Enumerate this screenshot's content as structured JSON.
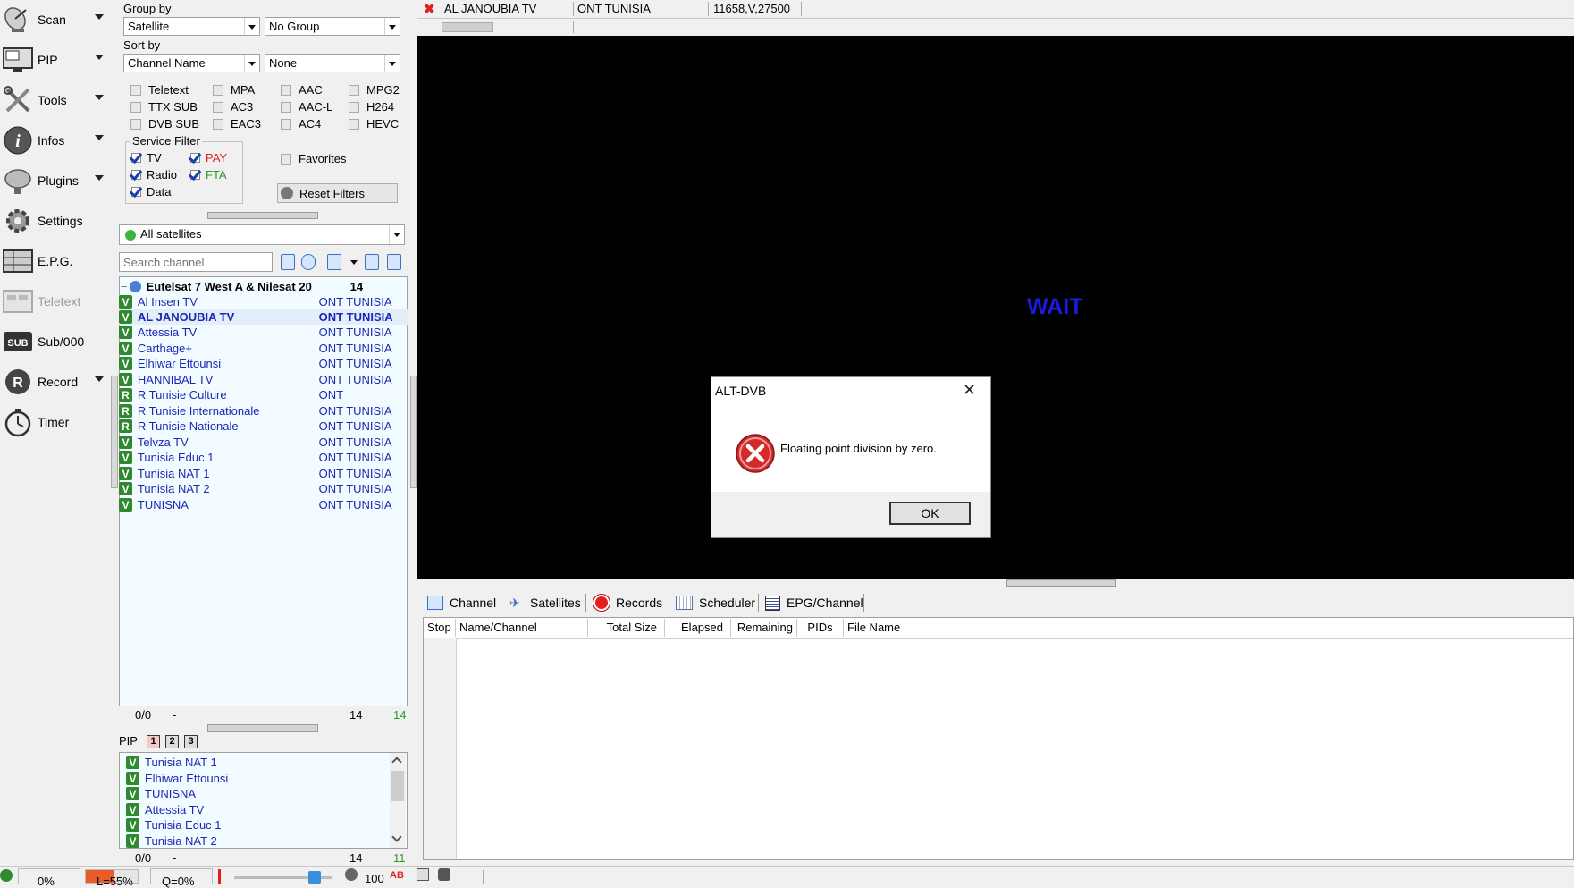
{
  "nav": {
    "items": [
      {
        "label": "Scan",
        "icon": "satellite-dish-icon",
        "caret": true
      },
      {
        "label": "PIP",
        "icon": "pip-monitor-icon",
        "caret": true
      },
      {
        "label": "Tools",
        "icon": "tools-icon",
        "caret": true
      },
      {
        "label": "Infos",
        "icon": "info-icon",
        "caret": true
      },
      {
        "label": "Plugins",
        "icon": "plugin-dish-icon",
        "caret": true
      },
      {
        "label": "Settings",
        "icon": "gear-icon",
        "caret": false
      },
      {
        "label": "E.P.G.",
        "icon": "epg-grid-icon",
        "caret": false
      },
      {
        "label": "Teletext",
        "icon": "teletext-icon",
        "caret": false,
        "disabled": true
      },
      {
        "label": "Sub/000",
        "icon": "subtitle-icon",
        "caret": false
      },
      {
        "label": "Record",
        "icon": "record-icon",
        "caret": true
      },
      {
        "label": "Timer",
        "icon": "timer-icon",
        "caret": false
      }
    ]
  },
  "filters": {
    "group_by_label": "Group by",
    "group_by_value": "Satellite",
    "group_by_secondary": "No Group",
    "sort_by_label": "Sort by",
    "sort_by_value": "Channel Name",
    "sort_by_secondary": "None",
    "stream_checks": [
      "Teletext",
      "MPA",
      "AAC",
      "MPG2",
      "TTX SUB",
      "AC3",
      "AAC-L",
      "H264",
      "DVB SUB",
      "EAC3",
      "AC4",
      "HEVC"
    ],
    "service_filter_label": "Service Filter",
    "service_tv": "TV",
    "service_pay": "PAY",
    "service_radio": "Radio",
    "service_fta": "FTA",
    "service_data": "Data",
    "favorites": "Favorites",
    "reset_filters": "Reset Filters",
    "satellite_select": "All satellites",
    "search_placeholder": "Search channel"
  },
  "channel_list": {
    "group_name": "Eutelsat 7 West A & Nilesat 20",
    "group_count": "14",
    "channels": [
      {
        "type": "V",
        "name": "Al Insen TV",
        "provider": "ONT TUNISIA"
      },
      {
        "type": "V",
        "name": "AL JANOUBIA TV",
        "provider": "ONT TUNISIA",
        "selected": true
      },
      {
        "type": "V",
        "name": "Attessia TV",
        "provider": "ONT TUNISIA"
      },
      {
        "type": "V",
        "name": "Carthage+",
        "provider": "ONT TUNISIA"
      },
      {
        "type": "V",
        "name": "Elhiwar Ettounsi",
        "provider": "ONT TUNISIA"
      },
      {
        "type": "V",
        "name": "HANNIBAL TV",
        "provider": "ONT TUNISIA"
      },
      {
        "type": "R",
        "name": "R Tunisie Culture",
        "provider": "ONT"
      },
      {
        "type": "R",
        "name": "R Tunisie Internationale",
        "provider": "ONT TUNISIA"
      },
      {
        "type": "R",
        "name": "R Tunisie Nationale",
        "provider": "ONT TUNISIA"
      },
      {
        "type": "V",
        "name": "Telvza TV",
        "provider": "ONT TUNISIA"
      },
      {
        "type": "V",
        "name": "Tunisia Educ 1",
        "provider": "ONT TUNISIA"
      },
      {
        "type": "V",
        "name": "Tunisia NAT 1",
        "provider": "ONT TUNISIA"
      },
      {
        "type": "V",
        "name": "Tunisia NAT 2",
        "provider": "ONT TUNISIA"
      },
      {
        "type": "V",
        "name": "TUNISNA",
        "provider": "ONT TUNISIA"
      }
    ],
    "status_pos": "0/0",
    "status_dash": "-",
    "status_total": "14",
    "status_shown": "14"
  },
  "pip": {
    "label": "PIP",
    "buttons": [
      "1",
      "2",
      "3"
    ],
    "channels": [
      {
        "type": "V",
        "name": "Tunisia NAT 1"
      },
      {
        "type": "V",
        "name": "Elhiwar Ettounsi"
      },
      {
        "type": "V",
        "name": "TUNISNA"
      },
      {
        "type": "V",
        "name": "Attessia TV"
      },
      {
        "type": "V",
        "name": "Tunisia Educ 1"
      },
      {
        "type": "V",
        "name": "Tunisia NAT 2"
      }
    ],
    "status_pos": "0/0",
    "status_dash": "-",
    "status_total": "14",
    "status_shown": "11"
  },
  "infobar": {
    "channel": "AL JANOUBIA TV",
    "provider": "ONT TUNISIA",
    "transponder": "11658,V,27500"
  },
  "video": {
    "wait_text": "WAIT"
  },
  "dialog": {
    "title": "ALT-DVB",
    "message": "Floating point division by zero.",
    "ok": "OK"
  },
  "bottom_tabs": {
    "tabs": [
      "Channel",
      "Satellites",
      "Records",
      "Scheduler",
      "EPG/Channel"
    ],
    "columns": [
      "Stop",
      "Name/Channel",
      "Total Size",
      "Elapsed",
      "Remaining",
      "PIDs",
      "File Name"
    ]
  },
  "statusbar": {
    "cpu": "0%",
    "level": "L=55%",
    "quality": "Q=0%",
    "volume": "100"
  },
  "colors": {
    "accent_blue": "#1a28b4",
    "wait_blue": "#1a1ae0",
    "badge_green": "#2f8a2f",
    "pay_red": "#e0201e",
    "fta_green": "#2a9a2a"
  }
}
